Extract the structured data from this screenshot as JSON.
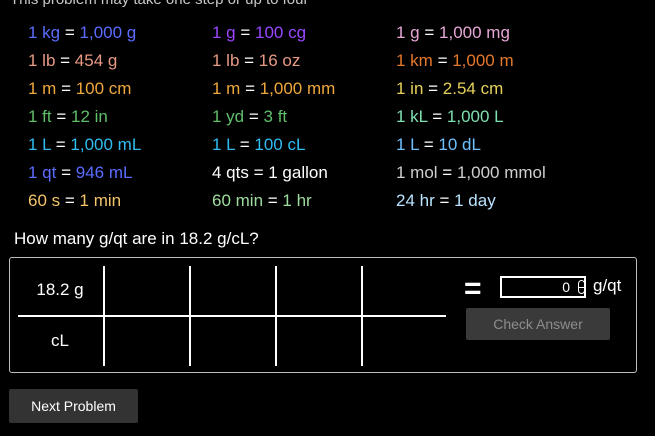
{
  "header": {
    "instructions": "This problem may take one step or up to four"
  },
  "colors": {
    "blue": "#5b6cff",
    "purple": "#9a46ff",
    "pink": "#e7a7d6",
    "salmon": "#e89a84",
    "orange": "#e6782c",
    "yellow": "#f0a83c",
    "gold": "#e6d25a",
    "green": "#5fbf6a",
    "mint": "#7fe0b0",
    "cyan": "#2fbdf2",
    "lightblue": "#6fc0ff",
    "gray": "#cfcfcf",
    "white": "#ffffff",
    "peach": "#f4c46a",
    "sage": "#9fdc9f",
    "sky": "#b9e3ff"
  },
  "conversions": [
    [
      {
        "left": "1 kg",
        "right": "1,000 g",
        "color": "blue"
      },
      {
        "left": "1 g",
        "right": "100 cg",
        "color": "purple"
      },
      {
        "left": "1 g",
        "right": "1,000 mg",
        "color": "pink"
      }
    ],
    [
      {
        "left": "1 lb",
        "right": "454 g",
        "color": "salmon"
      },
      {
        "left": "1 lb",
        "right": "16 oz",
        "color": "salmon"
      },
      {
        "left": "1 km",
        "right": "1,000 m",
        "color": "orange"
      }
    ],
    [
      {
        "left": "1 m",
        "right": "100 cm",
        "color": "yellow"
      },
      {
        "left": "1 m",
        "right": "1,000 mm",
        "color": "yellow"
      },
      {
        "left": "1 in",
        "right": "2.54 cm",
        "color": "gold"
      }
    ],
    [
      {
        "left": "1 ft",
        "right": "12 in",
        "color": "green"
      },
      {
        "left": "1 yd",
        "right": "3 ft",
        "color": "green"
      },
      {
        "left": "1 kL",
        "right": "1,000 L",
        "color": "mint"
      }
    ],
    [
      {
        "left": "1 L",
        "right": "1,000 mL",
        "color": "cyan"
      },
      {
        "left": "1 L",
        "right": "100 cL",
        "color": "cyan"
      },
      {
        "left": "1 L",
        "right": "10 dL",
        "color": "lightblue"
      }
    ],
    [
      {
        "left": "1 qt",
        "right": "946 mL",
        "color": "blue"
      },
      {
        "left": "4 qts",
        "right": "1 gallon",
        "color": "white"
      },
      {
        "left": "1 mol",
        "right": "1,000 mmol",
        "color": "gray"
      }
    ],
    [
      {
        "left": "60 s",
        "right": "1 min",
        "color": "peach"
      },
      {
        "left": "60 min",
        "right": "1 hr",
        "color": "sage"
      },
      {
        "left": "24 hr",
        "right": "1 day",
        "color": "sky"
      }
    ]
  ],
  "question": "How many g/qt are in 18.2 g/cL?",
  "work": {
    "numerator_1": "18.2 g",
    "denominator_1": "cL",
    "equals": "=",
    "answer_value": "0",
    "answer_unit": "g/qt"
  },
  "buttons": {
    "check": "Check Answer",
    "next": "Next Problem"
  }
}
